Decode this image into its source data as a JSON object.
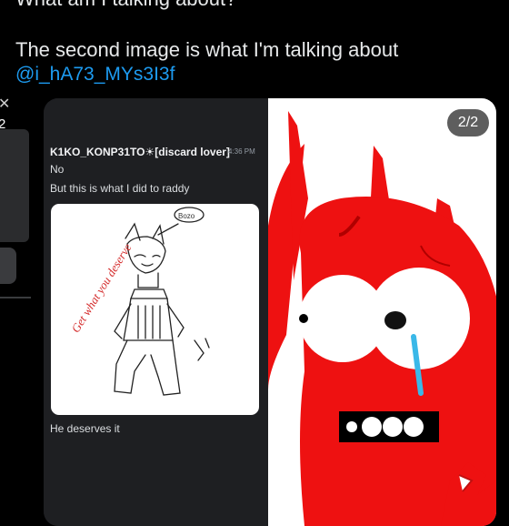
{
  "post": {
    "line1": "What am I talking about?",
    "line2": "The second image is what I'm talking about",
    "mention": "@i_hA73_MYs3I3f"
  },
  "left_pane": {
    "close_glyph": "✕",
    "counter": "2"
  },
  "discord": {
    "username": "K1KO_KONP31TO☀[discard lover]",
    "time": "4:36 PM",
    "msg1": "No",
    "msg2": "But this is what I did to raddy",
    "msg3": "He deserves it",
    "drawing_caption": "Get what you deserve",
    "drawing_tag": "Bozo"
  },
  "media": {
    "counter": "2/2"
  },
  "colors": {
    "mention": "#1d9bf0",
    "character_red": "#ee1111",
    "discord_bg": "#1e1f22"
  }
}
